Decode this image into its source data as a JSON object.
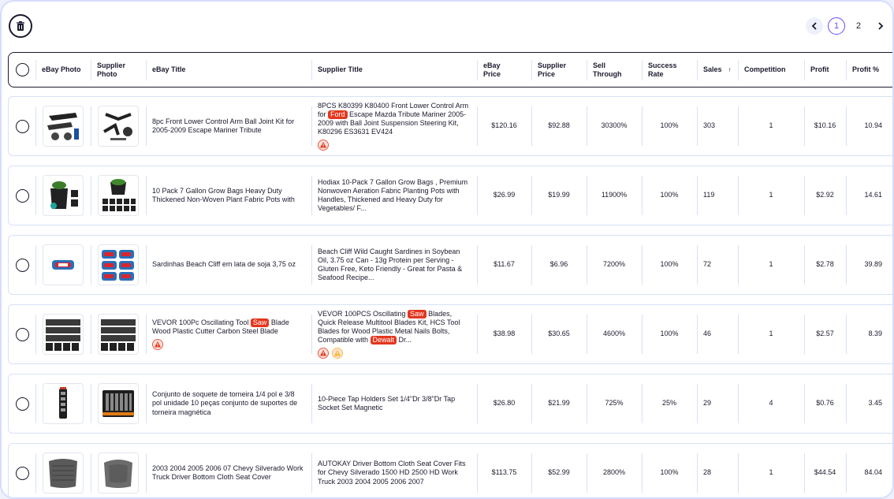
{
  "toolbar": {
    "delete_icon": "trash-icon"
  },
  "pagination": {
    "prev": "‹",
    "pages": [
      "1",
      "2"
    ],
    "current": "1",
    "next": "›"
  },
  "columns": {
    "ebay_photo": "eBay Photo",
    "supplier_photo": "Supplier Photo",
    "ebay_title": "eBay Title",
    "supplier_title": "Supplier Title",
    "ebay_price": "eBay Price",
    "supplier_price": "Supplier Price",
    "sell_through": "Sell Through",
    "success_rate": "Success Rate",
    "sales": "Sales",
    "sales_sort": "↑",
    "competition": "Competition",
    "profit": "Profit",
    "profit_pct": "Profit %"
  },
  "rows": [
    {
      "ebay_title": "8pc Front Lower Control Arm Ball Joint Kit for 2005-2009 Escape Mariner Tribute",
      "ebay_tags": [],
      "supplier_title": {
        "pre": "8PCS K80399 K80400 Front Lower Control Arm for ",
        "tag": "Ford",
        "post": " Escape Mazda Tribute Mariner 2005-2009 with Ball Joint Suspension Steering Kit, K80296 ES3631 EV424"
      },
      "supplier_warnings": [
        "red"
      ],
      "ebay_price": "$120.16",
      "supplier_price": "$92.88",
      "sell_through": "30300%",
      "success_rate": "100%",
      "sales": "303",
      "competition": "1",
      "profit": "$10.16",
      "profit_pct": "10.94"
    },
    {
      "ebay_title": "10 Pack 7 Gallon Grow Bags Heavy Duty Thickened Non-Woven Plant Fabric Pots with",
      "supplier_title": {
        "pre": "Hodiax 10-Pack 7 Gallon Grow Bags , Premium Nonwoven Aeration Fabric Planting Pots with Handles, Thickened and Heavy Duty for Vegetables/ F...",
        "tag": "",
        "post": ""
      },
      "supplier_warnings": [],
      "ebay_price": "$26.99",
      "supplier_price": "$19.99",
      "sell_through": "11900%",
      "success_rate": "100%",
      "sales": "119",
      "competition": "1",
      "profit": "$2.92",
      "profit_pct": "14.61"
    },
    {
      "ebay_title": "Sardinhas Beach Cliff em lata de soja 3,75 oz",
      "supplier_title": {
        "pre": "Beach Cliff Wild Caught Sardines in Soybean Oil, 3.75 oz Can - 13g Protein per Serving - Gluten Free, Keto Friendly - Great for Pasta & Seafood Recipe...",
        "tag": "",
        "post": ""
      },
      "supplier_warnings": [],
      "ebay_price": "$11.67",
      "supplier_price": "$6.96",
      "sell_through": "7200%",
      "success_rate": "100%",
      "sales": "72",
      "competition": "1",
      "profit": "$2.78",
      "profit_pct": "39.89"
    },
    {
      "ebay_title": {
        "pre": "VEVOR 100Pc Oscillating Tool ",
        "tag": "Saw",
        "post": " Blade Wood Plastic Cutter Carbon Steel Blade"
      },
      "ebay_warnings": [
        "red"
      ],
      "supplier_title": {
        "pre": "VEVOR 100PCS Oscillating ",
        "tag": "Saw",
        "post": " Blades, Quick Release Multitool Blades Kit, HCS Tool Blades for Wood Plastic Metal Nails Bolts, Compatible with ",
        "tag2": "Dewalt",
        "post2": " Dr..."
      },
      "supplier_warnings": [
        "red",
        "yellow"
      ],
      "ebay_price": "$38.98",
      "supplier_price": "$30.65",
      "sell_through": "4600%",
      "success_rate": "100%",
      "sales": "46",
      "competition": "1",
      "profit": "$2.57",
      "profit_pct": "8.39"
    },
    {
      "ebay_title": "Conjunto de soquete de torneira 1/4 pol e 3/8 pol unidade 10 peças conjunto de suportes de torneira magnética",
      "supplier_title": {
        "pre": "10-Piece Tap Holders Set 1/4\"Dr 3/8\"Dr Tap Socket Set Magnetic",
        "tag": "",
        "post": ""
      },
      "supplier_warnings": [],
      "ebay_price": "$26.80",
      "supplier_price": "$21.99",
      "sell_through": "725%",
      "success_rate": "25%",
      "sales": "29",
      "competition": "4",
      "profit": "$0.76",
      "profit_pct": "3.45"
    },
    {
      "ebay_title": "2003 2004 2005 2006 07 Chevy Silverado Work Truck Driver Bottom Cloth Seat Cover",
      "supplier_title": {
        "pre": "AUTOKAY Driver Bottom Cloth Seat Cover Fits for Chevy Silverado 1500 HD 2500 HD Work Truck 2003 2004 2005 2006 2007",
        "tag": "",
        "post": ""
      },
      "supplier_warnings": [],
      "ebay_price": "$113.75",
      "supplier_price": "$52.99",
      "sell_through": "2800%",
      "success_rate": "100%",
      "sales": "28",
      "competition": "1",
      "profit": "$44.54",
      "profit_pct": "84.04"
    }
  ],
  "colors": {
    "accent": "#6a4cf5",
    "tag_red": "#e4361e",
    "warn_yellow": "#f3b71d",
    "border": "#d7e1f6"
  }
}
